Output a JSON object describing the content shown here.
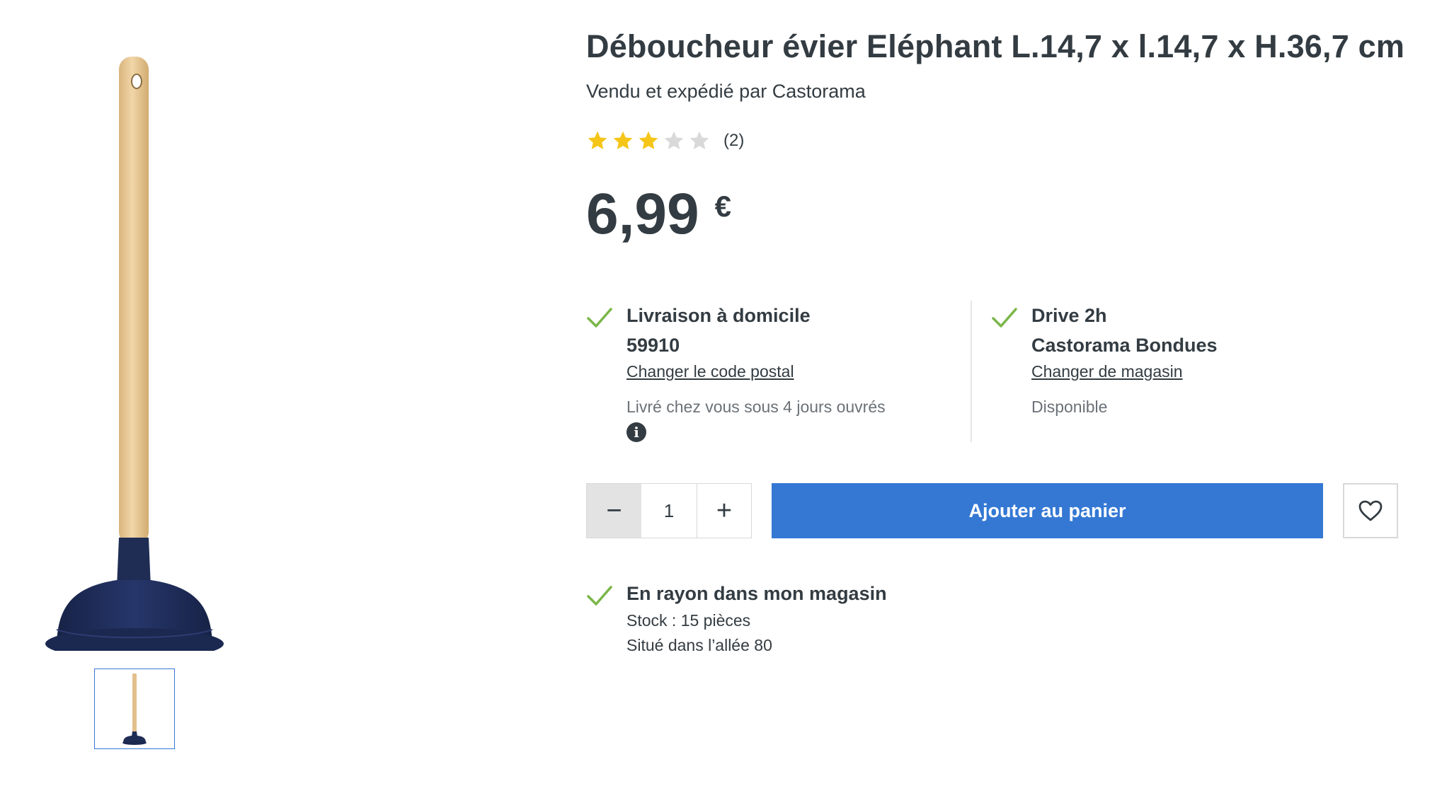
{
  "product": {
    "title": "Déboucheur évier Eléphant L.14,7 x l.14,7 x H.36,7 cm",
    "seller": "Vendu et expédié par Castorama",
    "rating": {
      "value": 3,
      "max": 5,
      "count_label": "(2)"
    },
    "price": {
      "value": "6,99",
      "currency": "€"
    }
  },
  "delivery": {
    "home": {
      "title": "Livraison à domicile",
      "postal_code": "59910",
      "change_link": "Changer le code postal",
      "note": "Livré chez vous sous 4 jours ouvrés"
    },
    "drive": {
      "title": "Drive 2h",
      "store": "Castorama Bondues",
      "change_link": "Changer de magasin",
      "note": "Disponible"
    }
  },
  "cart": {
    "quantity": "1",
    "minus_label": "−",
    "plus_label": "+",
    "add_label": "Ajouter au panier"
  },
  "store_stock": {
    "title": "En rayon dans mon magasin",
    "stock_line": "Stock : 15 pièces",
    "aisle_line": "Situé dans l’allée 80"
  },
  "colors": {
    "primary_blue": "#3478d4",
    "check_green": "#7ab648",
    "star_gold": "#f5c518",
    "star_empty": "#d9d9d9",
    "text_dark": "#333c42",
    "plunger_navy": "#1f2d55",
    "handle_wood": "#e8c99a"
  },
  "icons": {
    "check": "check-icon",
    "info": "info-icon",
    "heart": "heart-icon",
    "star": "star-icon"
  }
}
